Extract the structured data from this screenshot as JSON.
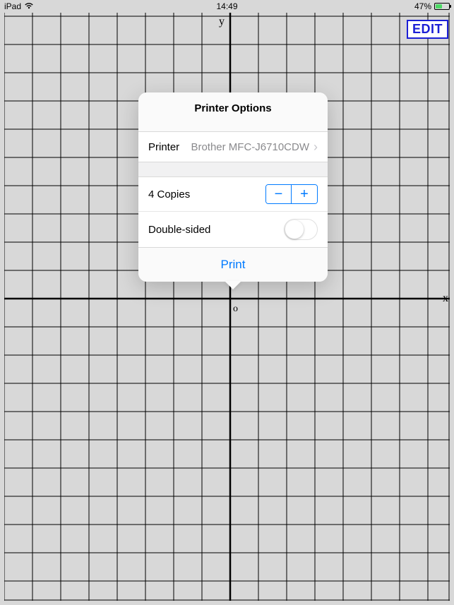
{
  "statusbar": {
    "device": "iPad",
    "time": "14:49",
    "battery_percent": "47%"
  },
  "graph": {
    "y_axis_label": "y",
    "x_axis_label": "x",
    "origin_label": "o"
  },
  "edit_button": {
    "label": "EDIT"
  },
  "popover": {
    "title": "Printer Options",
    "printer_row": {
      "label": "Printer",
      "value": "Brother MFC-J6710CDW"
    },
    "copies_row": {
      "label": "4 Copies",
      "minus": "−",
      "plus": "+"
    },
    "double_sided_row": {
      "label": "Double-sided",
      "on": false
    },
    "print_button": "Print"
  }
}
